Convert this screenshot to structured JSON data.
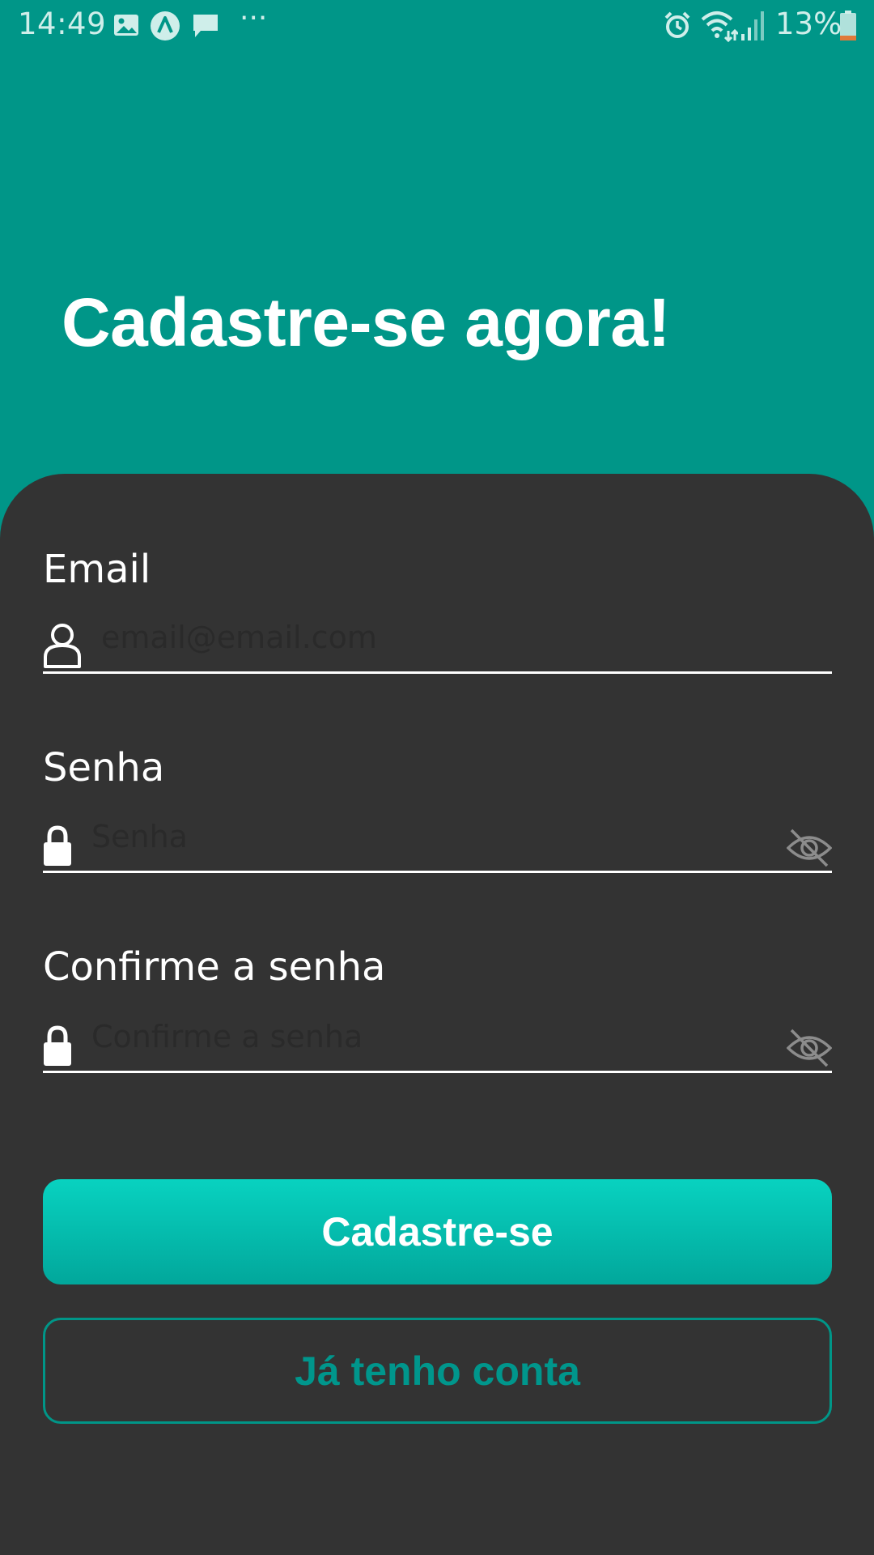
{
  "status_bar": {
    "time": "14:49",
    "battery_percent": "13%",
    "overflow_dots": "···",
    "icons": [
      "image-icon",
      "navigation-icon",
      "chat-icon",
      "alarm-icon",
      "wifi-icon",
      "signal-icon",
      "battery-icon"
    ]
  },
  "header": {
    "title": "Cadastre-se agora!"
  },
  "form": {
    "email": {
      "label": "Email",
      "placeholder": "email@email.com",
      "value": "",
      "icon": "user-icon"
    },
    "password": {
      "label": "Senha",
      "placeholder": "Senha",
      "value": "",
      "icon": "lock-icon",
      "toggle_icon": "eye-off-icon"
    },
    "confirm_password": {
      "label": "Confirme a senha",
      "placeholder": "Confirme a senha",
      "value": "",
      "icon": "lock-icon",
      "toggle_icon": "eye-off-icon"
    }
  },
  "actions": {
    "signup_label": "Cadastre-se",
    "have_account_label": "Já tenho conta"
  },
  "colors": {
    "header_bg": "#009688",
    "card_bg": "#333333",
    "primary_button_gradient": [
      "#08d2c0",
      "#02a79b"
    ],
    "secondary_button_text": "#00968c",
    "white": "#ffffff"
  }
}
